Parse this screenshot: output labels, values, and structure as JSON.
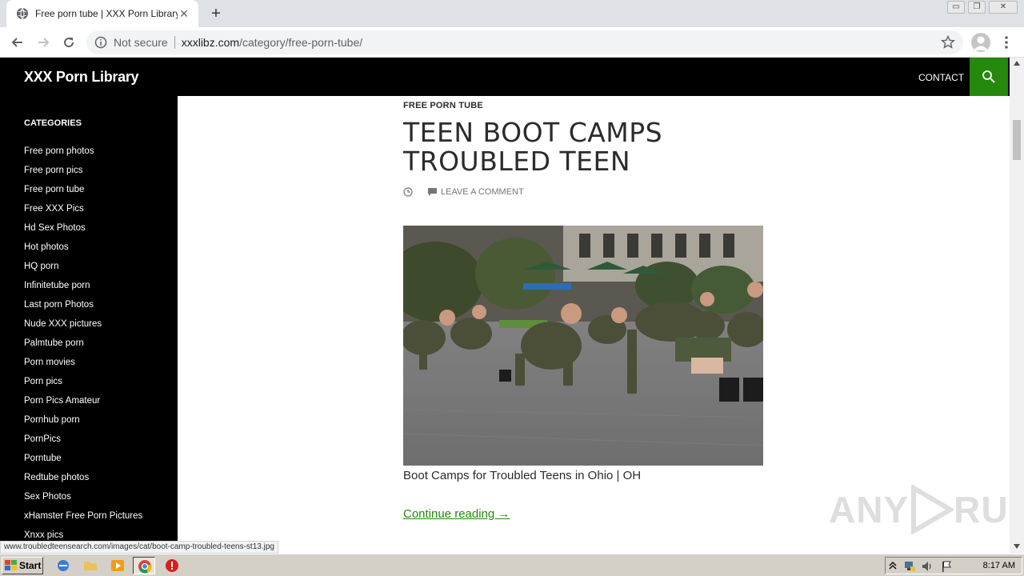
{
  "browser": {
    "tab_title": "Free porn tube | XXX Porn Library",
    "tab_close": "✕",
    "new_tab": "+",
    "window_controls": [
      "▭",
      "❐",
      "✕"
    ],
    "omnibox": {
      "security_label": "Not secure",
      "host": "xxxlibz.com",
      "path": "/category/free-porn-tube/"
    },
    "status_url": "www.troubledteensearch.com/images/cat/boot-camp-troubled-teens-st13.jpg"
  },
  "site": {
    "title": "XXX Porn Library",
    "nav_contact": "CONTACT",
    "accent": "#24890d"
  },
  "sidebar": {
    "heading": "CATEGORIES",
    "items": [
      "Free porn photos",
      "Free porn pics",
      "Free porn tube",
      "Free XXX Pics",
      "Hd Sex Photos",
      "Hot photos",
      "HQ porn",
      "Infinitetube porn",
      "Last porn Photos",
      "Nude XXX pictures",
      "Palmtube porn",
      "Porn movies",
      "Porn pics",
      "Porn Pics Amateur",
      "Pornhub porn",
      "PornPics",
      "Porntube",
      "Redtube photos",
      "Sex Photos",
      "xHamster Free Porn Pictures",
      "Xnxx pics"
    ]
  },
  "post": {
    "category": "FREE PORN TUBE",
    "title_line1": "TEEN BOOT CAMPS",
    "title_line2": "TROUBLED TEEN",
    "comment_link": "LEAVE A COMMENT",
    "caption": "Boot Camps for Troubled Teens in Ohio | OH",
    "continue": "Continue reading →"
  },
  "watermark": {
    "left": "ANY",
    "right": "RUN"
  },
  "taskbar": {
    "start_label": "Start",
    "time": "8:17 AM"
  }
}
